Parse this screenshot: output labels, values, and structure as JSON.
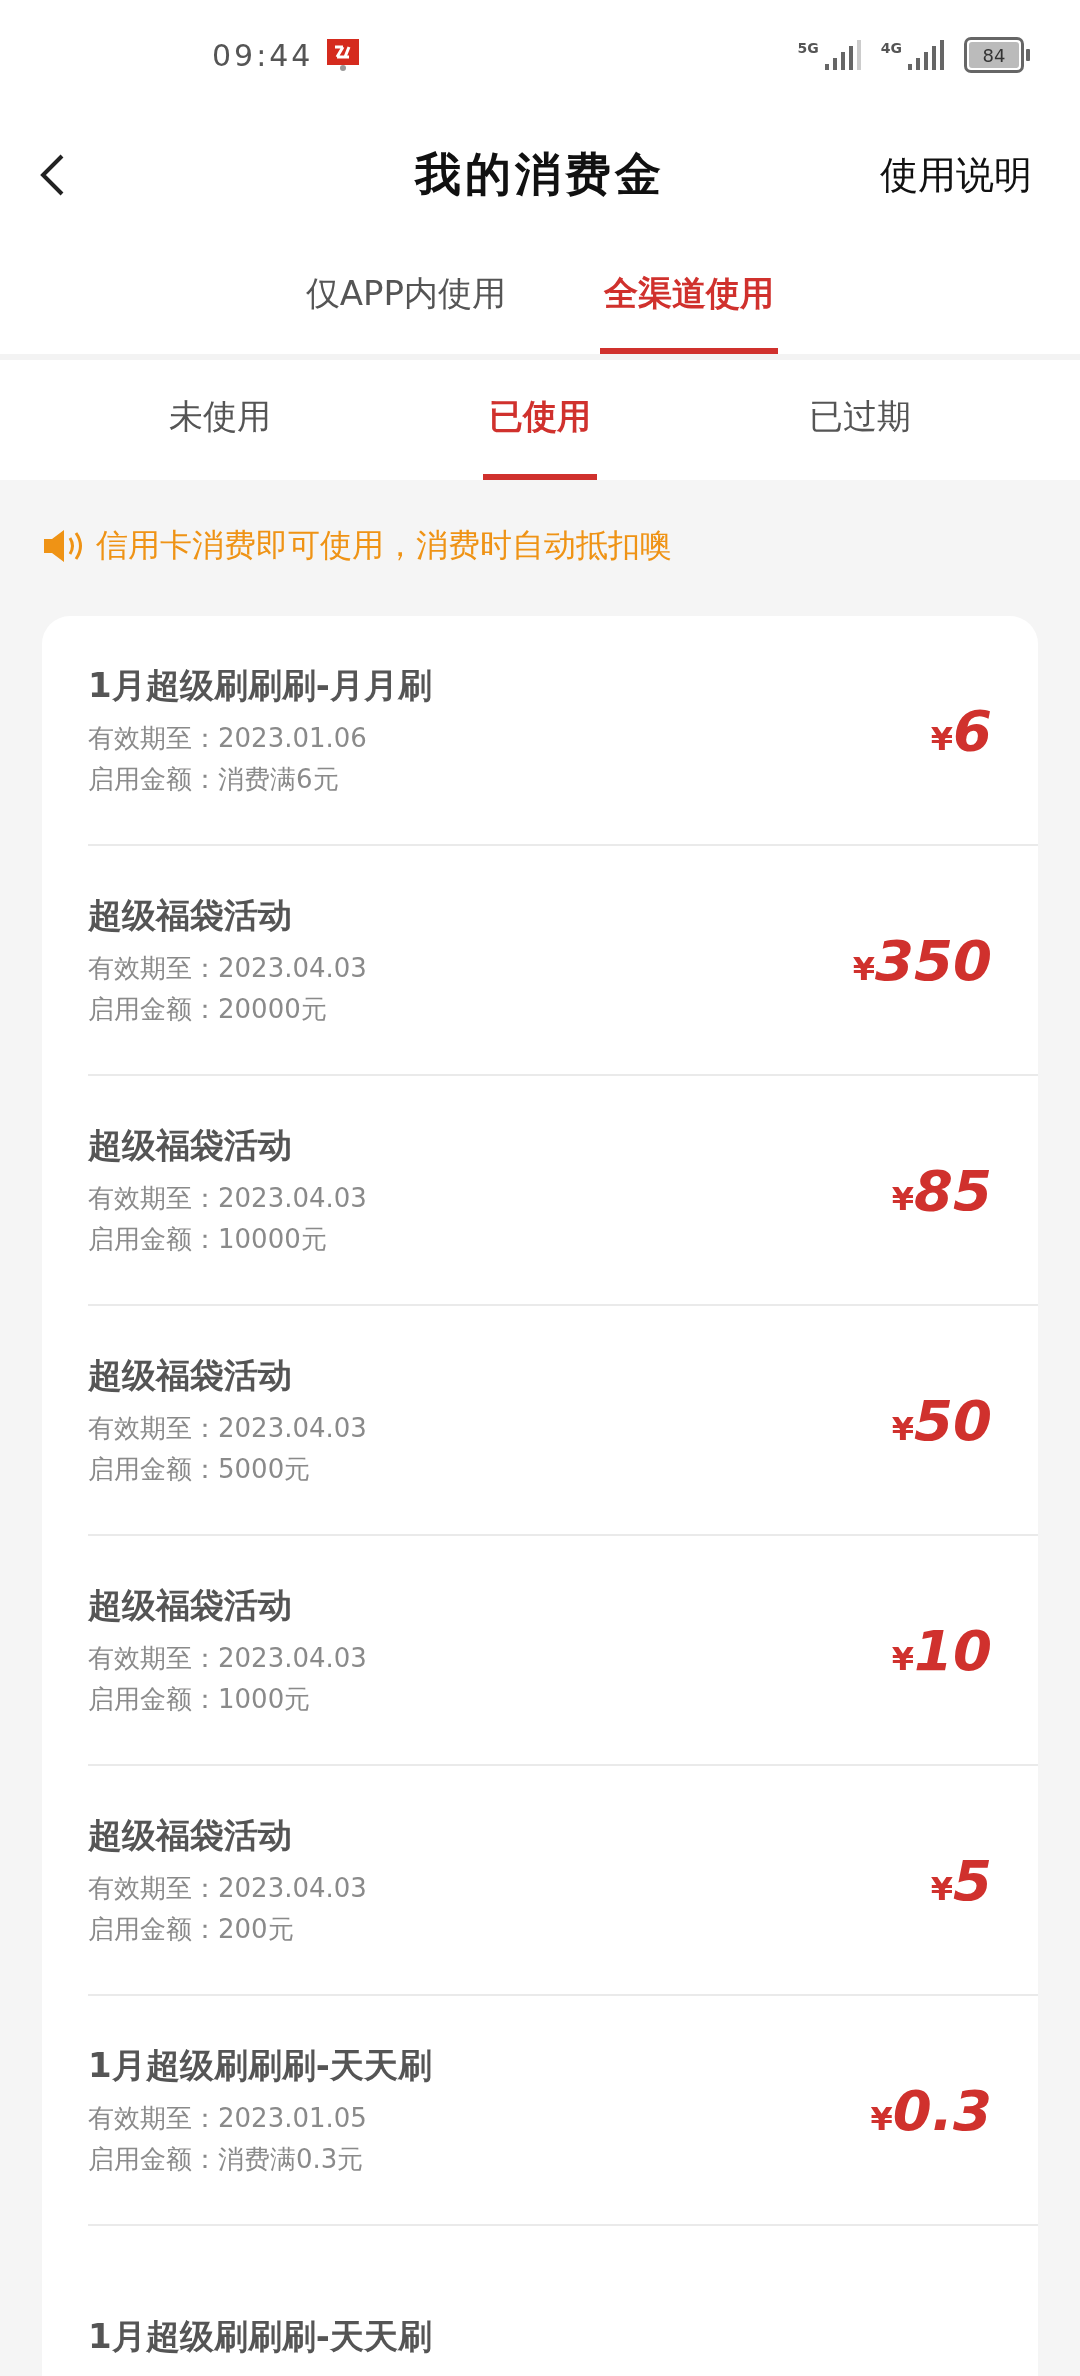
{
  "status_bar": {
    "time": "09:44",
    "network_1": "5G",
    "network_2": "4G",
    "battery": "84"
  },
  "header": {
    "title": "我的消费金",
    "action": "使用说明"
  },
  "channel_tabs": [
    {
      "label": "仅APP内使用",
      "selected": false
    },
    {
      "label": "全渠道使用",
      "selected": true
    }
  ],
  "status_tabs": [
    {
      "label": "未使用",
      "selected": false
    },
    {
      "label": "已使用",
      "selected": true
    },
    {
      "label": "已过期",
      "selected": false
    }
  ],
  "notice": "信用卡消费即可使用，消费时自动抵扣噢",
  "coupons": [
    {
      "title": "1月超级刷刷刷-月月刷",
      "expiry": "有效期至：2023.01.06",
      "threshold": "启用金额：消费满6元",
      "currency": "¥",
      "amount": "6"
    },
    {
      "title": "超级福袋活动",
      "expiry": "有效期至：2023.04.03",
      "threshold": "启用金额：20000元",
      "currency": "¥",
      "amount": "350"
    },
    {
      "title": "超级福袋活动",
      "expiry": "有效期至：2023.04.03",
      "threshold": "启用金额：10000元",
      "currency": "¥",
      "amount": "85"
    },
    {
      "title": "超级福袋活动",
      "expiry": "有效期至：2023.04.03",
      "threshold": "启用金额：5000元",
      "currency": "¥",
      "amount": "50"
    },
    {
      "title": "超级福袋活动",
      "expiry": "有效期至：2023.04.03",
      "threshold": "启用金额：1000元",
      "currency": "¥",
      "amount": "10"
    },
    {
      "title": "超级福袋活动",
      "expiry": "有效期至：2023.04.03",
      "threshold": "启用金额：200元",
      "currency": "¥",
      "amount": "5"
    },
    {
      "title": "1月超级刷刷刷-天天刷",
      "expiry": "有效期至：2023.01.05",
      "threshold": "启用金额：消费满0.3元",
      "currency": "¥",
      "amount": "0.3"
    },
    {
      "title": "1月超级刷刷刷-天天刷"
    }
  ]
}
